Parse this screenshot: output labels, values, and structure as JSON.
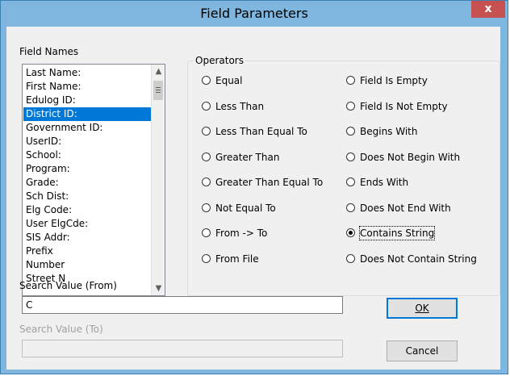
{
  "window": {
    "title": "Field Parameters",
    "close_glyph": "x"
  },
  "fields": {
    "label": "Field Names",
    "items": [
      "Last Name:",
      "First Name:",
      "Edulog ID:",
      "District ID:",
      "Government ID:",
      "UserID:",
      "School:",
      "Program:",
      "Grade:",
      "Sch Dist:",
      "Elg Code:",
      "User ElgCde:",
      "SIS Addr:",
      "Prefix",
      "Number",
      "Street N"
    ],
    "selected": "District ID:"
  },
  "operators": {
    "label": "Operators",
    "left": [
      "Equal",
      "Less Than",
      "Less Than Equal To",
      "Greater Than",
      "Greater Than Equal To",
      "Not Equal To",
      "From -> To",
      "From File"
    ],
    "right": [
      "Field Is Empty",
      "Field Is Not Empty",
      "Begins With",
      "Does Not Begin With",
      "Ends With",
      "Does Not End With",
      "Contains String",
      "Does Not Contain String"
    ],
    "selected": "Contains String"
  },
  "search_from": {
    "label": "Search Value (From)",
    "value": "C"
  },
  "search_to": {
    "label": "Search Value (To)",
    "value": ""
  },
  "buttons": {
    "ok": "OK",
    "cancel": "Cancel"
  }
}
